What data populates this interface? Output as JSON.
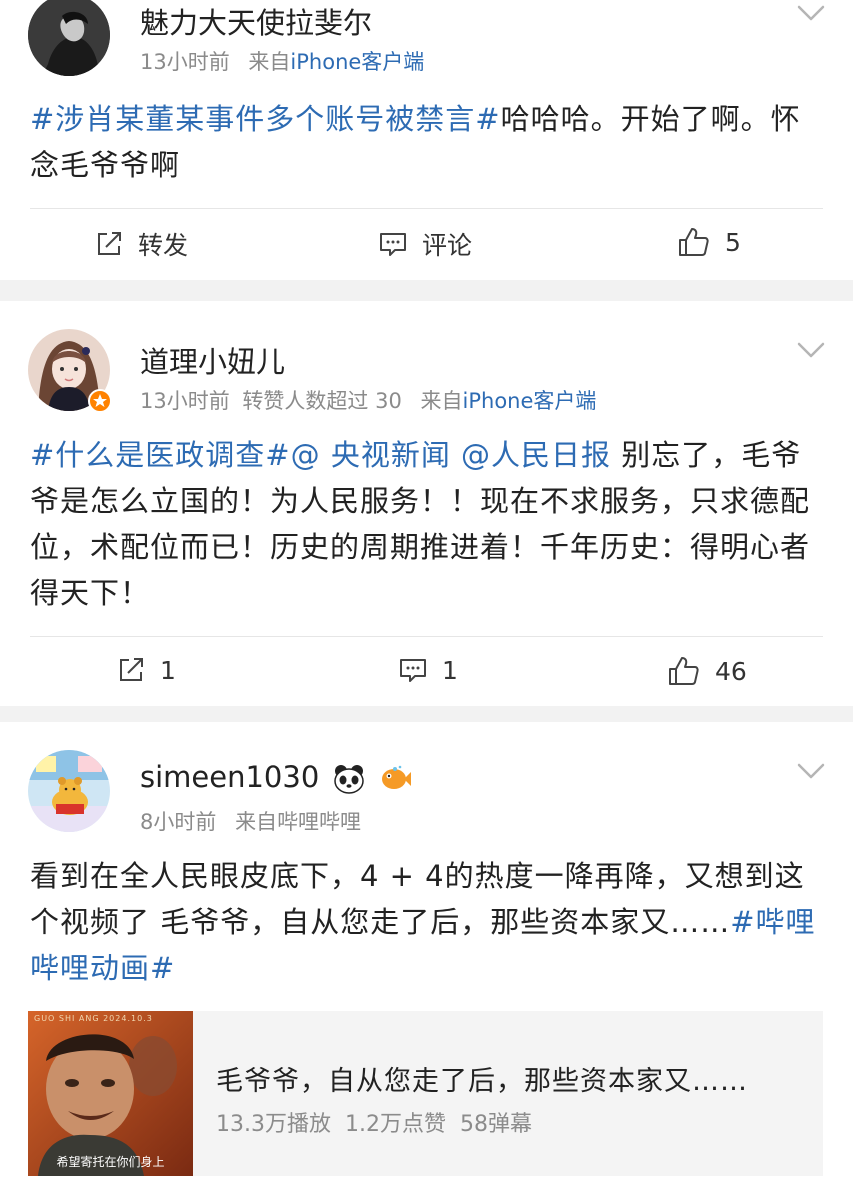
{
  "posts": [
    {
      "username": "魅力大天使拉斐尔",
      "time": "13小时前",
      "extra": "",
      "source_prefix": "来自",
      "source": "iPhone客户端",
      "tag1": "#涉肖某董某事件多个账号被禁言#",
      "text1": "哈哈哈。开始了啊。怀念毛爷爷啊",
      "actions": {
        "repost": "转发",
        "comment": "评论",
        "like": "5"
      }
    },
    {
      "username": "道理小妞儿",
      "time": "13小时前",
      "extra": "转赞人数超过 30",
      "source_prefix": "来自",
      "source": "iPhone客户端",
      "tag1": "#什么是医政调查#",
      "mention1": "@ 央视新闻",
      "mention2": "@人民日报",
      "text1": "别忘了，毛爷爷是怎么立国的！为人民服务！！现在不求服务，只求德配位，术配位而已！历史的周期推进着！千年历史：得明心者得天下！",
      "actions": {
        "repost": "1",
        "comment": "1",
        "like": "46"
      }
    },
    {
      "username": "simeen1030",
      "time": "8小时前",
      "extra": "",
      "source_prefix": "来自",
      "source": "哔哩哔哩",
      "text1": "看到在全人民眼皮底下，4 + 4的热度一降再降，又想到这个视频了 毛爷爷，自从您走了后，那些资本家又……",
      "tag1": "#哔哩哔哩动画#",
      "video": {
        "title": "毛爷爷，自从您走了后，那些资本家又……",
        "plays": "13.3万播放",
        "likes": "1.2万点赞",
        "danmaku": "58弹幕",
        "thumb_caption": "希望寄托在你们身上",
        "thumb_header": "GUO SHI ANG 2024.10.3"
      }
    }
  ],
  "colors": {
    "link": "#2d6bb3",
    "meta": "#8b8b8b",
    "background": "#f2f2f2"
  },
  "icons": [
    "avatar-dark-silhouette",
    "avatar-girl",
    "avatar-cartoon-bear",
    "chevron-down-icon",
    "repost-icon",
    "comment-icon",
    "like-icon",
    "panda-emoji",
    "fish-emoji",
    "vip-badge-icon"
  ]
}
